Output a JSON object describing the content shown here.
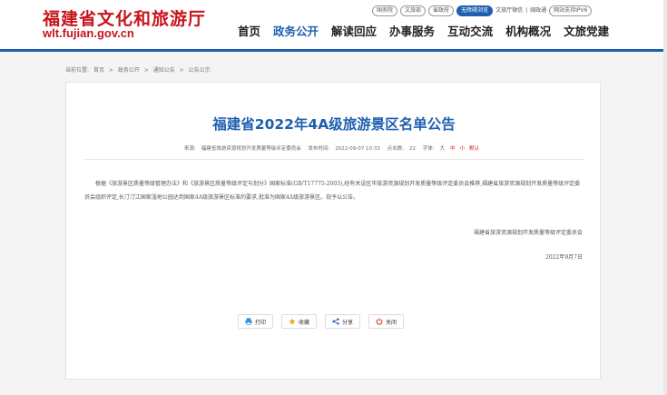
{
  "site": {
    "name_cn": "福建省文化和旅游厅",
    "domain": "wlt.fujian.gov.cn"
  },
  "toplinks": [
    {
      "label": "国务院",
      "style": "pill"
    },
    {
      "label": "文旅部",
      "style": "pill"
    },
    {
      "label": "省政府",
      "style": "pill"
    },
    {
      "label": "无障碍浏览",
      "style": "active"
    },
    {
      "label": "文旅厅微信",
      "style": "plain"
    },
    {
      "label": "|",
      "style": "plain"
    },
    {
      "label": "闽政通",
      "style": "plain"
    },
    {
      "label": "网站支持IPV6",
      "style": "pill"
    }
  ],
  "nav": [
    "首页",
    "政务公开",
    "解读回应",
    "办事服务",
    "互动交流",
    "机构概况",
    "文旅党建"
  ],
  "nav_active": "政务公开",
  "breadcrumb": [
    "当前位置:",
    "首页",
    ">",
    "政务公开",
    ">",
    "通知公告",
    ">",
    "公告公示"
  ],
  "article": {
    "title": "福建省2022年4A级旅游景区名单公告",
    "source_label": "来源:",
    "source": "福建省旅游资源规划开发质量等级评定委员会",
    "time_label": "发布时间:",
    "time": "2022-09-07 10:33",
    "hits_label": "点击数:",
    "hits": "22",
    "font_label": "字体:",
    "font_large": "大",
    "font_medium": "中",
    "font_small": "小",
    "font_default": "默认",
    "body": "根据《旅游景区质量等级管理办法》和《旅游景区质量等级评定与划分》国家标准(GB/T17775-2003),经有关设区市旅游资源规划开发质量等级评定委员会推荐,福建省旅游资源规划开发质量等级评定委员会组织评定,长汀汀江国家湿地公园达到国家4A级旅游景区标准的要求,批准为国家4A级旅游景区。现予以公告。",
    "signature": "福建省旅游资源规划开发质量等级评定委员会",
    "date": "2022年9月7日"
  },
  "actions": {
    "print": "打印",
    "favorite": "收藏",
    "share": "分享",
    "close": "关闭"
  },
  "colors": {
    "brand_red": "#c8141c",
    "accent_blue": "#1e5fb0"
  }
}
